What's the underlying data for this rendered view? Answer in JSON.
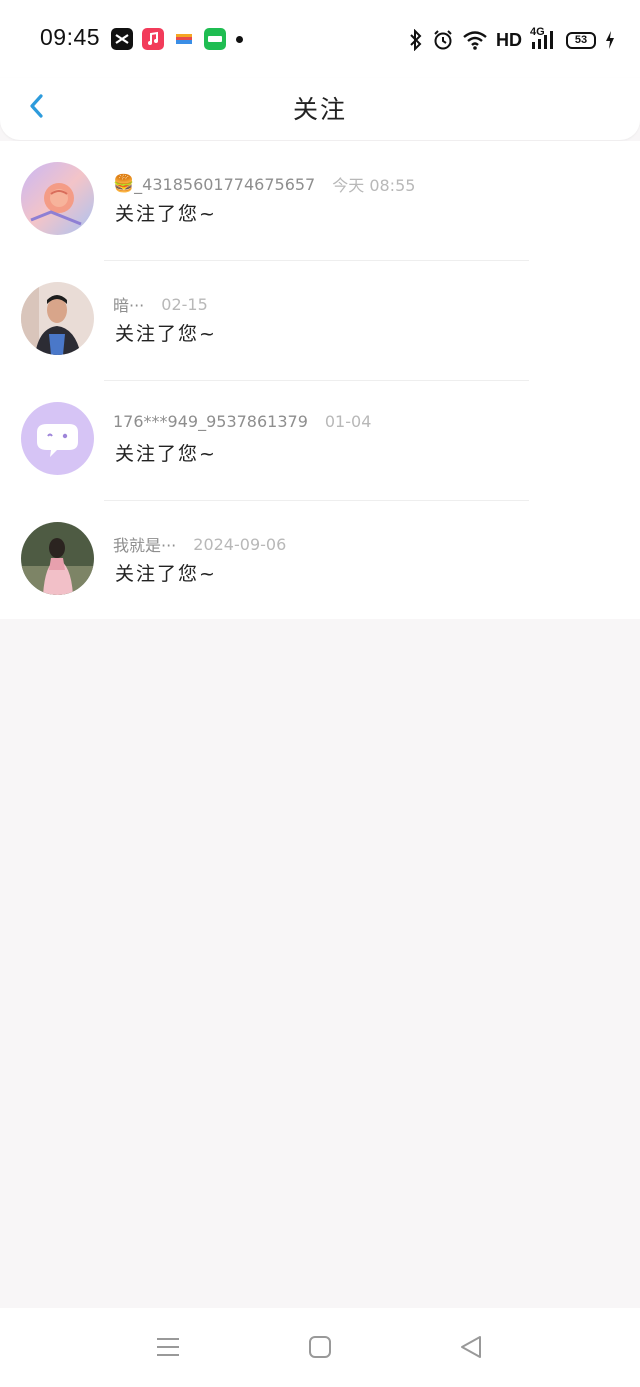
{
  "status_bar": {
    "time": "09:45",
    "network": "HD",
    "cellular": "4G",
    "battery": "53",
    "app_icons": [
      "capcut-icon",
      "music-icon",
      "wallet-icon",
      "iqiyi-icon"
    ],
    "icons": [
      "bluetooth-icon",
      "alarm-icon",
      "wifi-icon",
      "signal-icon",
      "charging-icon"
    ]
  },
  "header": {
    "title": "关注",
    "back_icon": "chevron-left-icon",
    "accent_color": "#2d9bdc"
  },
  "follows": [
    {
      "prefix": "🍔",
      "username": "_43185601774675657",
      "date": "今天 08:55",
      "message": "关注了您~"
    },
    {
      "prefix": "",
      "username": "暗···",
      "date": "02-15",
      "message": "关注了您~"
    },
    {
      "prefix": "",
      "username": "176***949_9537861379",
      "date": "01-04",
      "message": "关注了您~"
    },
    {
      "prefix": "",
      "username": "我就是···",
      "date": "2024-09-06",
      "message": "关注了您~"
    }
  ],
  "nav_bar": {
    "buttons": [
      "menu-icon",
      "home-square-icon",
      "back-triangle-icon"
    ]
  }
}
